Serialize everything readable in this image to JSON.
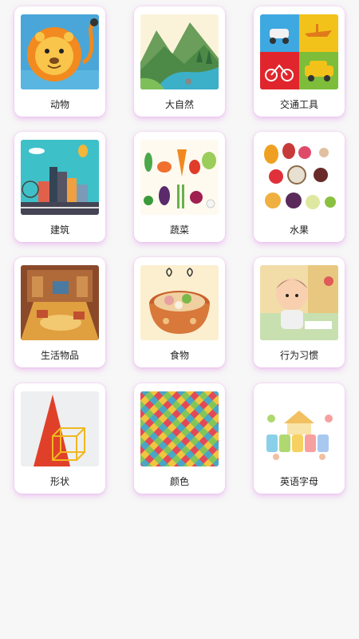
{
  "categories": [
    {
      "label": "动物",
      "icon": "lion-icon"
    },
    {
      "label": "大自然",
      "icon": "landscape-icon"
    },
    {
      "label": "交通工具",
      "icon": "vehicles-icon"
    },
    {
      "label": "建筑",
      "icon": "city-icon"
    },
    {
      "label": "蔬菜",
      "icon": "vegetables-icon"
    },
    {
      "label": "水果",
      "icon": "fruits-icon"
    },
    {
      "label": "生活物品",
      "icon": "living-room-icon"
    },
    {
      "label": "食物",
      "icon": "hotpot-icon"
    },
    {
      "label": "行为习惯",
      "icon": "child-washing-icon"
    },
    {
      "label": "形状",
      "icon": "shapes-icon"
    },
    {
      "label": "颜色",
      "icon": "color-pattern-icon"
    },
    {
      "label": "英语字母",
      "icon": "english-letters-icon"
    }
  ]
}
